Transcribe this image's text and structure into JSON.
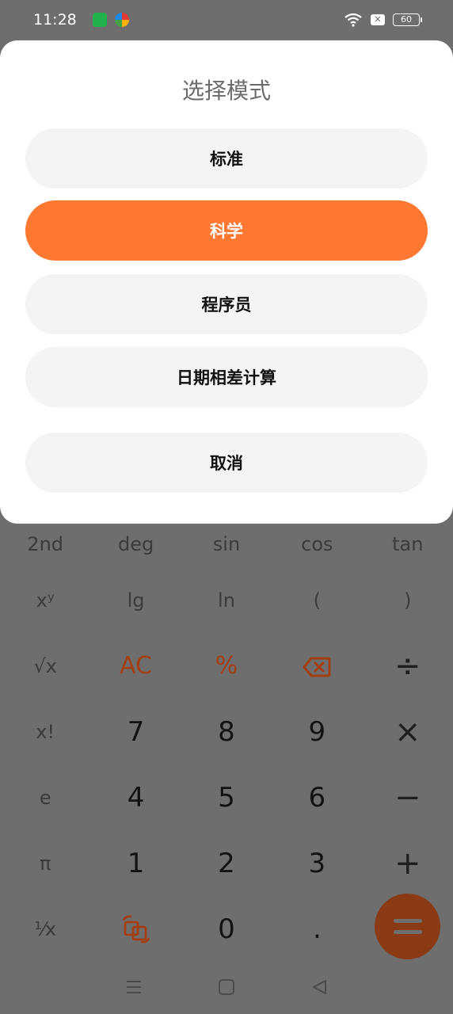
{
  "status_bar": {
    "time": "11:28",
    "battery": "60"
  },
  "modal": {
    "title": "选择模式",
    "options": [
      {
        "label": "标准",
        "selected": false
      },
      {
        "label": "科学",
        "selected": true
      },
      {
        "label": "程序员",
        "selected": false
      },
      {
        "label": "日期相差计算",
        "selected": false
      }
    ],
    "cancel_label": "取消"
  },
  "keypad": {
    "rows": [
      [
        "2nd",
        "deg",
        "sin",
        "cos",
        "tan"
      ],
      [
        "xʸ",
        "lg",
        "ln",
        "(",
        ")"
      ],
      [
        "√x",
        "AC",
        "%",
        "backspace-icon",
        "÷"
      ],
      [
        "x!",
        "7",
        "8",
        "9",
        "×"
      ],
      [
        "e",
        "4",
        "5",
        "6",
        "−"
      ],
      [
        "π",
        "1",
        "2",
        "3",
        "+"
      ],
      [
        "¹⁄x",
        "swap-icon",
        "0",
        ".",
        "="
      ]
    ]
  },
  "colors": {
    "accent": "#ff7832",
    "overlay": "#6e6e6e",
    "option_bg": "#f4f4f4"
  }
}
